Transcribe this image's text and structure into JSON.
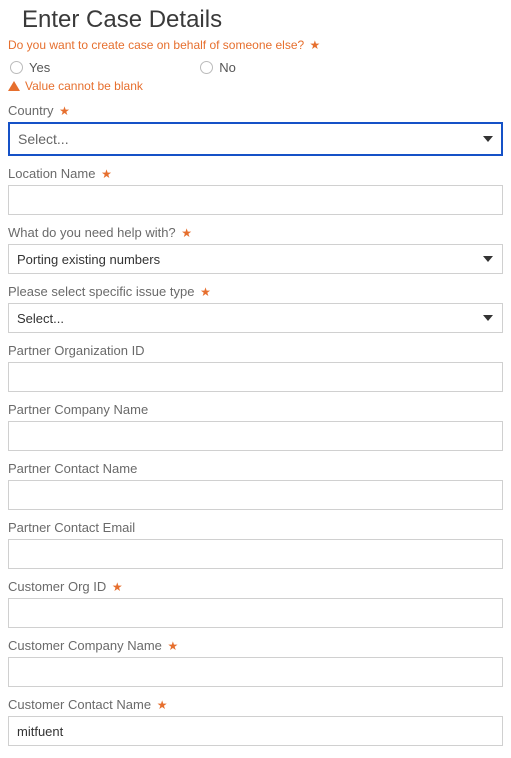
{
  "title": "Enter Case Details",
  "behalf_question": "Do you want to create case on behalf of someone else?",
  "radio_yes": "Yes",
  "radio_no": "No",
  "error_blank": "Value cannot be blank",
  "fields": {
    "country": {
      "label": "Country",
      "value": "Select...",
      "required": true
    },
    "location_name": {
      "label": "Location Name",
      "value": "",
      "required": true
    },
    "help_with": {
      "label": "What do you need help with?",
      "value": "Porting existing numbers",
      "required": true
    },
    "issue_type": {
      "label": "Please select specific issue type",
      "value": "Select...",
      "required": true
    },
    "partner_org_id": {
      "label": "Partner Organization ID",
      "value": "",
      "required": false
    },
    "partner_company": {
      "label": "Partner Company Name",
      "value": "",
      "required": false
    },
    "partner_contact_name": {
      "label": "Partner Contact Name",
      "value": "",
      "required": false
    },
    "partner_contact_email": {
      "label": "Partner Contact Email",
      "value": "",
      "required": false
    },
    "customer_org_id": {
      "label": "Customer Org ID",
      "value": "",
      "required": true
    },
    "customer_company": {
      "label": "Customer Company Name",
      "value": "",
      "required": true
    },
    "customer_contact_name": {
      "label": "Customer Contact Name",
      "value": "mitfuent",
      "required": true
    }
  }
}
